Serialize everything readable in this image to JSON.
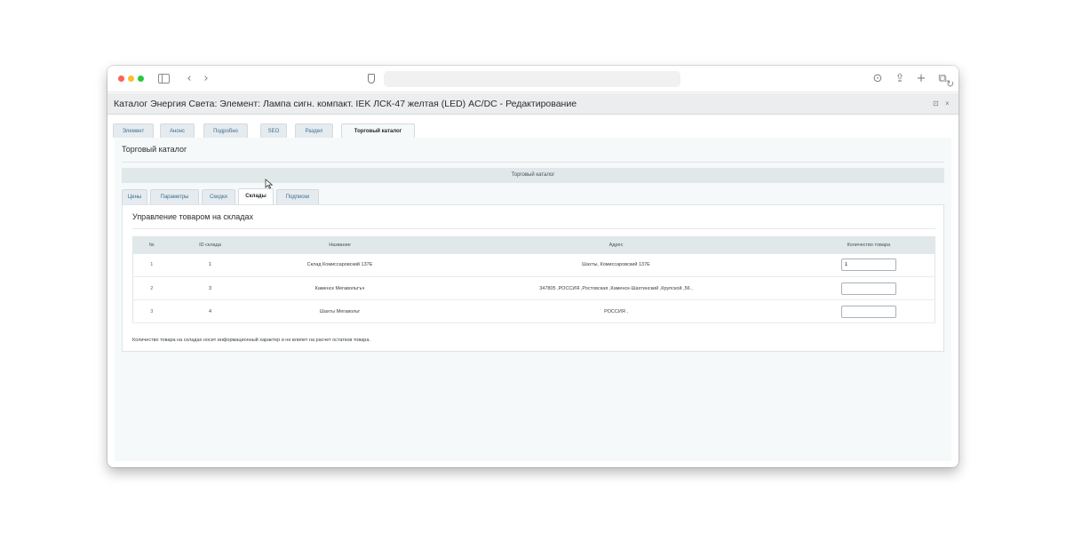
{
  "window": {
    "title": "Каталог Энергия Света: Элемент: Лампа сигн. компакт. IEK ЛСК-47 желтая (LED) AC/DC - Редактирование",
    "restore_icon": "restore-icon",
    "close_icon": "close-icon",
    "restore_glyph": "⊡",
    "close_glyph": "×"
  },
  "browser": {
    "back_glyph": "‹",
    "forward_glyph": "›",
    "reload_glyph": "↻",
    "download_glyph": "⊙",
    "share_glyph": "⇪",
    "new_tab_glyph": "+",
    "tabs_glyph": "⧉"
  },
  "outer_tabs": [
    "Элемент",
    "Анонс",
    "Подробно",
    "SEO",
    "Раздел",
    "Торговый каталог"
  ],
  "outer_active": "Торговый каталог",
  "section_heading": "Торговый каталог",
  "catalog_bar": "Торговый каталог",
  "inner_tabs": [
    "Цены",
    "Параметры",
    "Скидки",
    "Склады",
    "Подписки"
  ],
  "inner_active": "Склады",
  "panel_title": "Управление товаром на складах",
  "table": {
    "headers": [
      "№",
      "ID склада",
      "Название",
      "Адрес",
      "Количество товара"
    ],
    "rows": [
      {
        "num": "1",
        "id": "1",
        "name": "Склад Комиссаровский 137Е",
        "address": "Шахты, Комиссаровский 137Е",
        "qty": "1"
      },
      {
        "num": "2",
        "id": "3",
        "name": "Каменск Мегавольтъч",
        "address": "347805 ,РОССИЯ ,Ростовская ,Каменск-Шахтинский ,Крупской ,56 ,",
        "qty": ""
      },
      {
        "num": "3",
        "id": "4",
        "name": "Шахты Мегавольт",
        "address": "РОССИЯ ,",
        "qty": ""
      }
    ]
  },
  "note": "Количество товара на складах носит информационный характер и не влияет на расчет остатков товара.",
  "colors": {
    "link": "#3d6d92",
    "header_bg": "#e0e8ea",
    "content_bg": "#f5f9f9"
  }
}
